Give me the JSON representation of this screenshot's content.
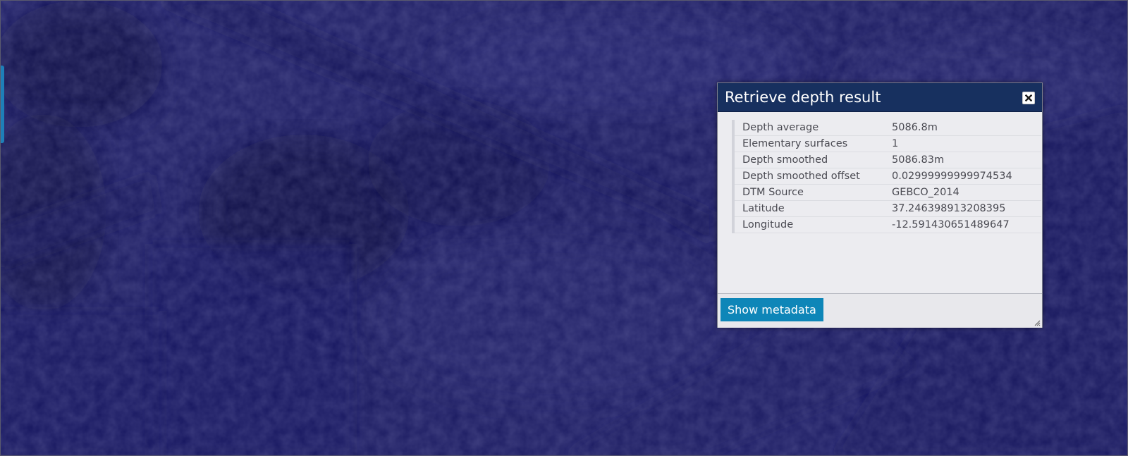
{
  "dialog": {
    "title": "Retrieve depth result",
    "close_icon": "close-icon",
    "rows": [
      {
        "key": "Depth average",
        "value": "5086.8m"
      },
      {
        "key": "Elementary surfaces",
        "value": "1"
      },
      {
        "key": "Depth smoothed",
        "value": "5086.83m"
      },
      {
        "key": "Depth smoothed offset",
        "value": "0.02999999999974534"
      },
      {
        "key": "DTM Source",
        "value": "GEBCO_2014"
      },
      {
        "key": "Latitude",
        "value": "37.246398913208395"
      },
      {
        "key": "Longitude",
        "value": "-12.591430651489647"
      }
    ],
    "show_metadata_label": "Show metadata"
  },
  "colors": {
    "map_base": "#1a1a5e",
    "map_dark": "#07073a",
    "header": "#17305f",
    "button": "#0e86b8",
    "panel_tab": "#1e7fb8"
  }
}
